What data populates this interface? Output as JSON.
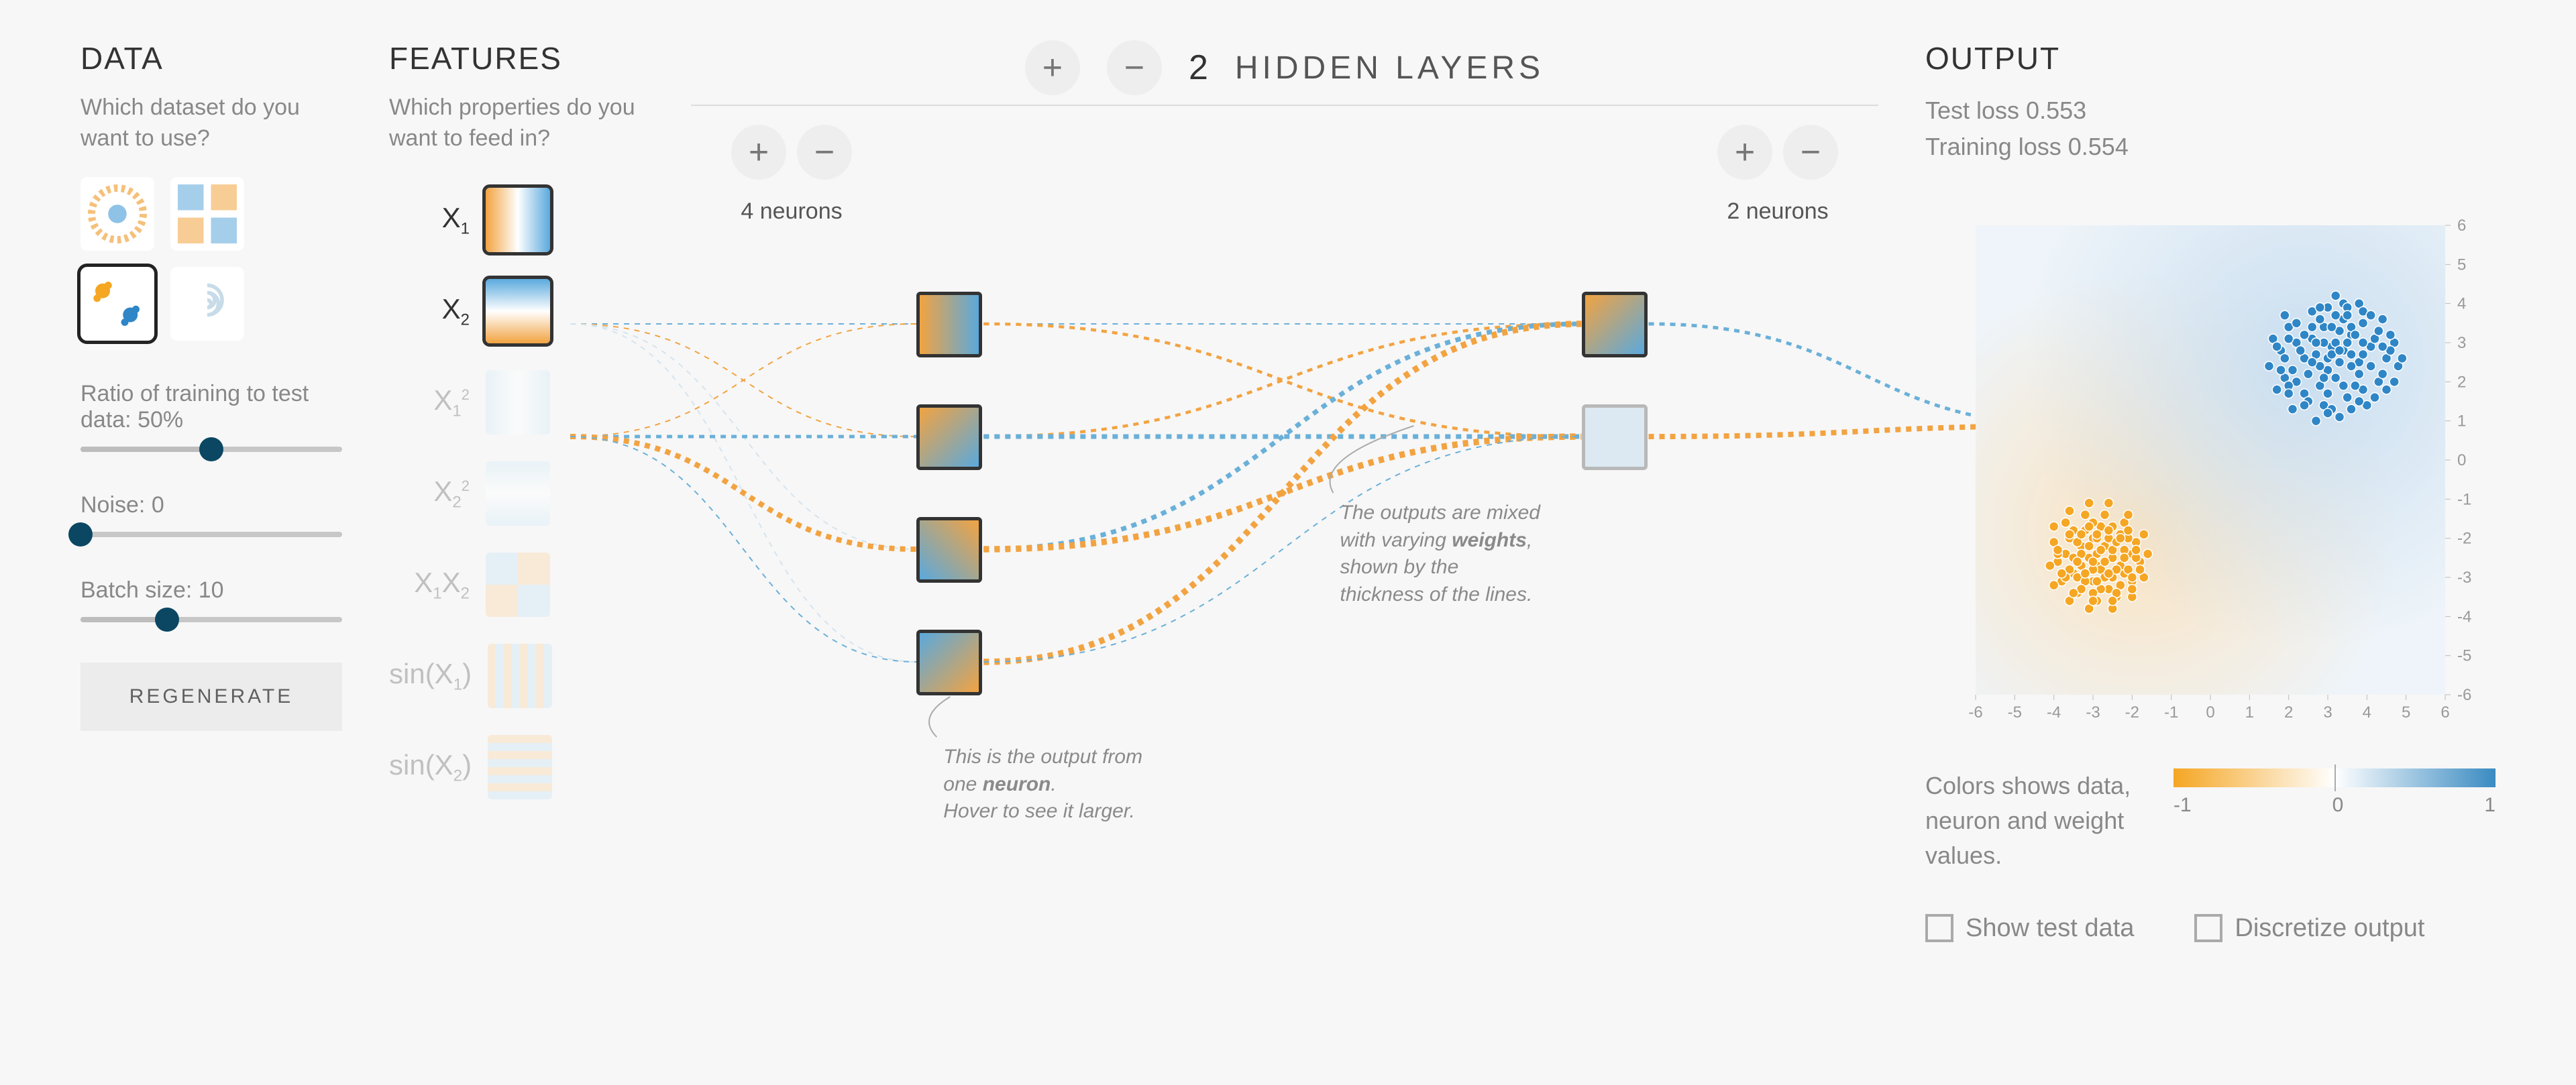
{
  "data_panel": {
    "title": "DATA",
    "question": "Which dataset do you want to use?",
    "datasets": [
      {
        "id": "circle",
        "selected": false
      },
      {
        "id": "xor",
        "selected": false
      },
      {
        "id": "gauss",
        "selected": true
      },
      {
        "id": "spiral",
        "selected": false
      }
    ],
    "ratio_label": "Ratio of training to test data:  50%",
    "ratio_value": 0.5,
    "noise_label": "Noise:  0",
    "noise_value": 0.0,
    "batch_label": "Batch size:  10",
    "batch_value": 0.33,
    "regenerate": "REGENERATE"
  },
  "features_panel": {
    "title": "FEATURES",
    "question": "Which properties do you want to feed in?",
    "items": [
      {
        "key": "x1",
        "label_html": "X<sub>1</sub>",
        "enabled": true
      },
      {
        "key": "x2",
        "label_html": "X<sub>2</sub>",
        "enabled": true
      },
      {
        "key": "x1sq",
        "label_html": "X<sub>1</sub><sup>2</sup>",
        "enabled": false
      },
      {
        "key": "x2sq",
        "label_html": "X<sub>2</sub><sup>2</sup>",
        "enabled": false
      },
      {
        "key": "x1x2",
        "label_html": "X<sub>1</sub>X<sub>2</sub>",
        "enabled": false
      },
      {
        "key": "sinx1",
        "label_html": "sin(X<sub>1</sub>)",
        "enabled": false
      },
      {
        "key": "sinx2",
        "label_html": "sin(X<sub>2</sub>)",
        "enabled": false
      }
    ]
  },
  "network": {
    "hidden_layers_count": "2",
    "hidden_layers_label": "HIDDEN LAYERS",
    "layers": [
      {
        "neurons": 4,
        "label": "4 neurons"
      },
      {
        "neurons": 2,
        "label": "2 neurons"
      }
    ],
    "note_neuron": [
      "This is the output from one ",
      "neuron",
      ".\nHover to see it larger."
    ],
    "note_weights": [
      "The outputs are mixed with varying ",
      "weights",
      ", shown by the thickness of the lines."
    ]
  },
  "output_panel": {
    "title": "OUTPUT",
    "test_loss": "Test loss 0.553",
    "train_loss": "Training loss 0.554",
    "legend_text": "Colors shows data, neuron and weight values.",
    "legend_ticks": [
      "-1",
      "0",
      "1"
    ],
    "check_show_test": "Show test data",
    "check_discretize": "Discretize output"
  },
  "chart_data": {
    "type": "scatter",
    "title": "",
    "xlabel": "",
    "ylabel": "",
    "xlim": [
      -6,
      6
    ],
    "ylim": [
      -6,
      6
    ],
    "x_ticks": [
      -6,
      -5,
      -4,
      -3,
      -2,
      -1,
      0,
      1,
      2,
      3,
      4,
      5,
      6
    ],
    "y_ticks": [
      -6,
      -5,
      -4,
      -3,
      -2,
      -1,
      0,
      1,
      2,
      3,
      4,
      5,
      6
    ],
    "series": [
      {
        "name": "class_blue",
        "color": "#2f86c6",
        "points": [
          [
            3.4,
            2.8
          ],
          [
            3.0,
            2.6
          ],
          [
            2.6,
            3.1
          ],
          [
            2.9,
            3.4
          ],
          [
            3.6,
            3.2
          ],
          [
            3.8,
            2.5
          ],
          [
            4.1,
            2.9
          ],
          [
            3.2,
            2.1
          ],
          [
            2.4,
            2.6
          ],
          [
            2.8,
            1.9
          ],
          [
            2.1,
            2.3
          ],
          [
            2.2,
            3.0
          ],
          [
            3.0,
            3.9
          ],
          [
            3.4,
            3.6
          ],
          [
            3.9,
            3.5
          ],
          [
            4.2,
            3.1
          ],
          [
            4.5,
            2.6
          ],
          [
            4.3,
            2.0
          ],
          [
            3.9,
            1.8
          ],
          [
            3.5,
            1.6
          ],
          [
            2.9,
            1.4
          ],
          [
            2.4,
            1.7
          ],
          [
            1.9,
            2.1
          ],
          [
            1.8,
            2.8
          ],
          [
            2.0,
            3.4
          ],
          [
            2.6,
            3.8
          ],
          [
            3.2,
            4.2
          ],
          [
            3.8,
            4.0
          ],
          [
            4.4,
            3.6
          ],
          [
            4.7,
            3.0
          ],
          [
            4.8,
            2.4
          ],
          [
            4.5,
            1.8
          ],
          [
            4.0,
            1.4
          ],
          [
            3.3,
            1.1
          ],
          [
            2.7,
            1.0
          ],
          [
            2.1,
            1.3
          ],
          [
            1.7,
            1.8
          ],
          [
            1.5,
            2.4
          ],
          [
            1.6,
            3.1
          ],
          [
            1.9,
            3.7
          ],
          [
            3.1,
            2.9
          ],
          [
            3.6,
            2.7
          ],
          [
            3.0,
            2.3
          ],
          [
            2.7,
            2.7
          ],
          [
            3.5,
            3.0
          ],
          [
            3.3,
            3.3
          ],
          [
            2.9,
            3.0
          ],
          [
            3.8,
            2.2
          ],
          [
            3.2,
            3.0
          ],
          [
            3.6,
            3.4
          ],
          [
            2.5,
            2.2
          ],
          [
            2.3,
            2.8
          ],
          [
            3.9,
            3.0
          ],
          [
            4.1,
            2.4
          ],
          [
            3.7,
            1.9
          ],
          [
            2.8,
            3.6
          ],
          [
            3.3,
            2.5
          ],
          [
            3.0,
            1.7
          ],
          [
            2.2,
            2.0
          ],
          [
            1.9,
            2.6
          ],
          [
            2.0,
            3.1
          ],
          [
            2.6,
            3.4
          ],
          [
            3.4,
            4.0
          ],
          [
            3.9,
            3.8
          ],
          [
            4.3,
            3.3
          ],
          [
            4.6,
            2.8
          ],
          [
            4.4,
            2.2
          ],
          [
            3.8,
            1.5
          ],
          [
            3.1,
            1.3
          ],
          [
            2.5,
            1.5
          ],
          [
            2.0,
            1.9
          ],
          [
            1.8,
            2.3
          ],
          [
            1.7,
            2.9
          ],
          [
            2.2,
            3.5
          ],
          [
            2.8,
            3.9
          ],
          [
            3.5,
            3.9
          ],
          [
            4.1,
            3.7
          ],
          [
            4.6,
            3.2
          ],
          [
            4.9,
            2.6
          ],
          [
            4.7,
            2.0
          ],
          [
            4.2,
            1.6
          ],
          [
            3.6,
            1.3
          ],
          [
            3.0,
            1.2
          ],
          [
            2.4,
            1.4
          ],
          [
            2.0,
            1.7
          ],
          [
            3.6,
            2.4
          ],
          [
            3.1,
            2.7
          ],
          [
            2.8,
            2.4
          ],
          [
            3.3,
            2.8
          ],
          [
            3.7,
            3.2
          ],
          [
            2.7,
            3.0
          ],
          [
            3.1,
            3.4
          ],
          [
            3.5,
            3.7
          ],
          [
            2.4,
            3.2
          ],
          [
            2.9,
            2.1
          ],
          [
            3.4,
            1.9
          ],
          [
            3.9,
            2.7
          ],
          [
            4.4,
            2.9
          ],
          [
            2.6,
            2.5
          ],
          [
            3.2,
            3.7
          ]
        ]
      },
      {
        "name": "class_orange",
        "color": "#f5a623",
        "points": [
          [
            -2.9,
            -2.7
          ],
          [
            -2.5,
            -2.5
          ],
          [
            -3.3,
            -2.2
          ],
          [
            -3.0,
            -3.1
          ],
          [
            -2.2,
            -2.9
          ],
          [
            -2.6,
            -3.3
          ],
          [
            -3.5,
            -2.9
          ],
          [
            -3.7,
            -2.4
          ],
          [
            -2.0,
            -2.4
          ],
          [
            -2.3,
            -1.9
          ],
          [
            -2.8,
            -1.7
          ],
          [
            -3.2,
            -1.8
          ],
          [
            -3.6,
            -2.0
          ],
          [
            -3.9,
            -2.6
          ],
          [
            -3.8,
            -3.1
          ],
          [
            -3.4,
            -3.4
          ],
          [
            -2.9,
            -3.6
          ],
          [
            -2.4,
            -3.5
          ],
          [
            -2.0,
            -3.1
          ],
          [
            -1.8,
            -2.6
          ],
          [
            -1.9,
            -2.1
          ],
          [
            -2.2,
            -1.6
          ],
          [
            -2.7,
            -1.4
          ],
          [
            -3.2,
            -1.4
          ],
          [
            -3.7,
            -1.6
          ],
          [
            -4.0,
            -2.1
          ],
          [
            -4.1,
            -2.7
          ],
          [
            -4.0,
            -3.2
          ],
          [
            -3.6,
            -3.6
          ],
          [
            -3.1,
            -3.8
          ],
          [
            -2.5,
            -3.8
          ],
          [
            -2.0,
            -3.5
          ],
          [
            -1.7,
            -3.0
          ],
          [
            -1.6,
            -2.4
          ],
          [
            -1.7,
            -1.9
          ],
          [
            -2.1,
            -1.4
          ],
          [
            -2.6,
            -1.1
          ],
          [
            -3.1,
            -1.1
          ],
          [
            -3.6,
            -1.3
          ],
          [
            -4.0,
            -1.7
          ],
          [
            -2.8,
            -2.8
          ],
          [
            -2.5,
            -3.0
          ],
          [
            -3.1,
            -2.5
          ],
          [
            -2.7,
            -2.2
          ],
          [
            -3.3,
            -2.7
          ],
          [
            -2.9,
            -2.4
          ],
          [
            -3.4,
            -3.0
          ],
          [
            -2.3,
            -2.7
          ],
          [
            -2.6,
            -2.0
          ],
          [
            -3.0,
            -2.0
          ],
          [
            -3.5,
            -2.5
          ],
          [
            -3.2,
            -3.1
          ],
          [
            -2.8,
            -3.3
          ],
          [
            -2.3,
            -3.2
          ],
          [
            -2.1,
            -2.8
          ],
          [
            -2.5,
            -2.3
          ],
          [
            -3.0,
            -2.8
          ],
          [
            -3.3,
            -2.4
          ],
          [
            -2.4,
            -2.1
          ],
          [
            -3.6,
            -2.8
          ],
          [
            -2.2,
            -2.3
          ],
          [
            -3.0,
            -3.4
          ],
          [
            -2.7,
            -3.0
          ],
          [
            -3.4,
            -2.1
          ],
          [
            -2.1,
            -2.0
          ],
          [
            -1.9,
            -2.5
          ],
          [
            -2.0,
            -3.0
          ],
          [
            -2.4,
            -3.4
          ],
          [
            -2.9,
            -3.1
          ],
          [
            -3.3,
            -3.3
          ],
          [
            -3.7,
            -3.0
          ],
          [
            -3.9,
            -2.4
          ],
          [
            -3.5,
            -1.8
          ],
          [
            -3.0,
            -1.6
          ],
          [
            -2.5,
            -1.7
          ],
          [
            -2.1,
            -1.8
          ],
          [
            -1.9,
            -2.3
          ],
          [
            -1.8,
            -2.8
          ],
          [
            -2.0,
            -3.3
          ],
          [
            -2.5,
            -3.6
          ],
          [
            -3.0,
            -3.6
          ],
          [
            -3.5,
            -3.4
          ],
          [
            -3.8,
            -2.9
          ],
          [
            -3.9,
            -2.3
          ],
          [
            -3.6,
            -1.9
          ],
          [
            -3.1,
            -1.7
          ],
          [
            -2.6,
            -1.8
          ],
          [
            -2.3,
            -2.0
          ],
          [
            -2.7,
            -2.6
          ],
          [
            -3.1,
            -2.2
          ],
          [
            -2.9,
            -2.0
          ],
          [
            -2.4,
            -2.8
          ],
          [
            -2.8,
            -2.3
          ],
          [
            -3.2,
            -2.9
          ],
          [
            -2.6,
            -2.9
          ],
          [
            -3.0,
            -2.6
          ],
          [
            -3.4,
            -2.6
          ],
          [
            -2.2,
            -2.5
          ],
          [
            -2.9,
            -1.9
          ],
          [
            -3.3,
            -1.9
          ]
        ]
      }
    ]
  }
}
